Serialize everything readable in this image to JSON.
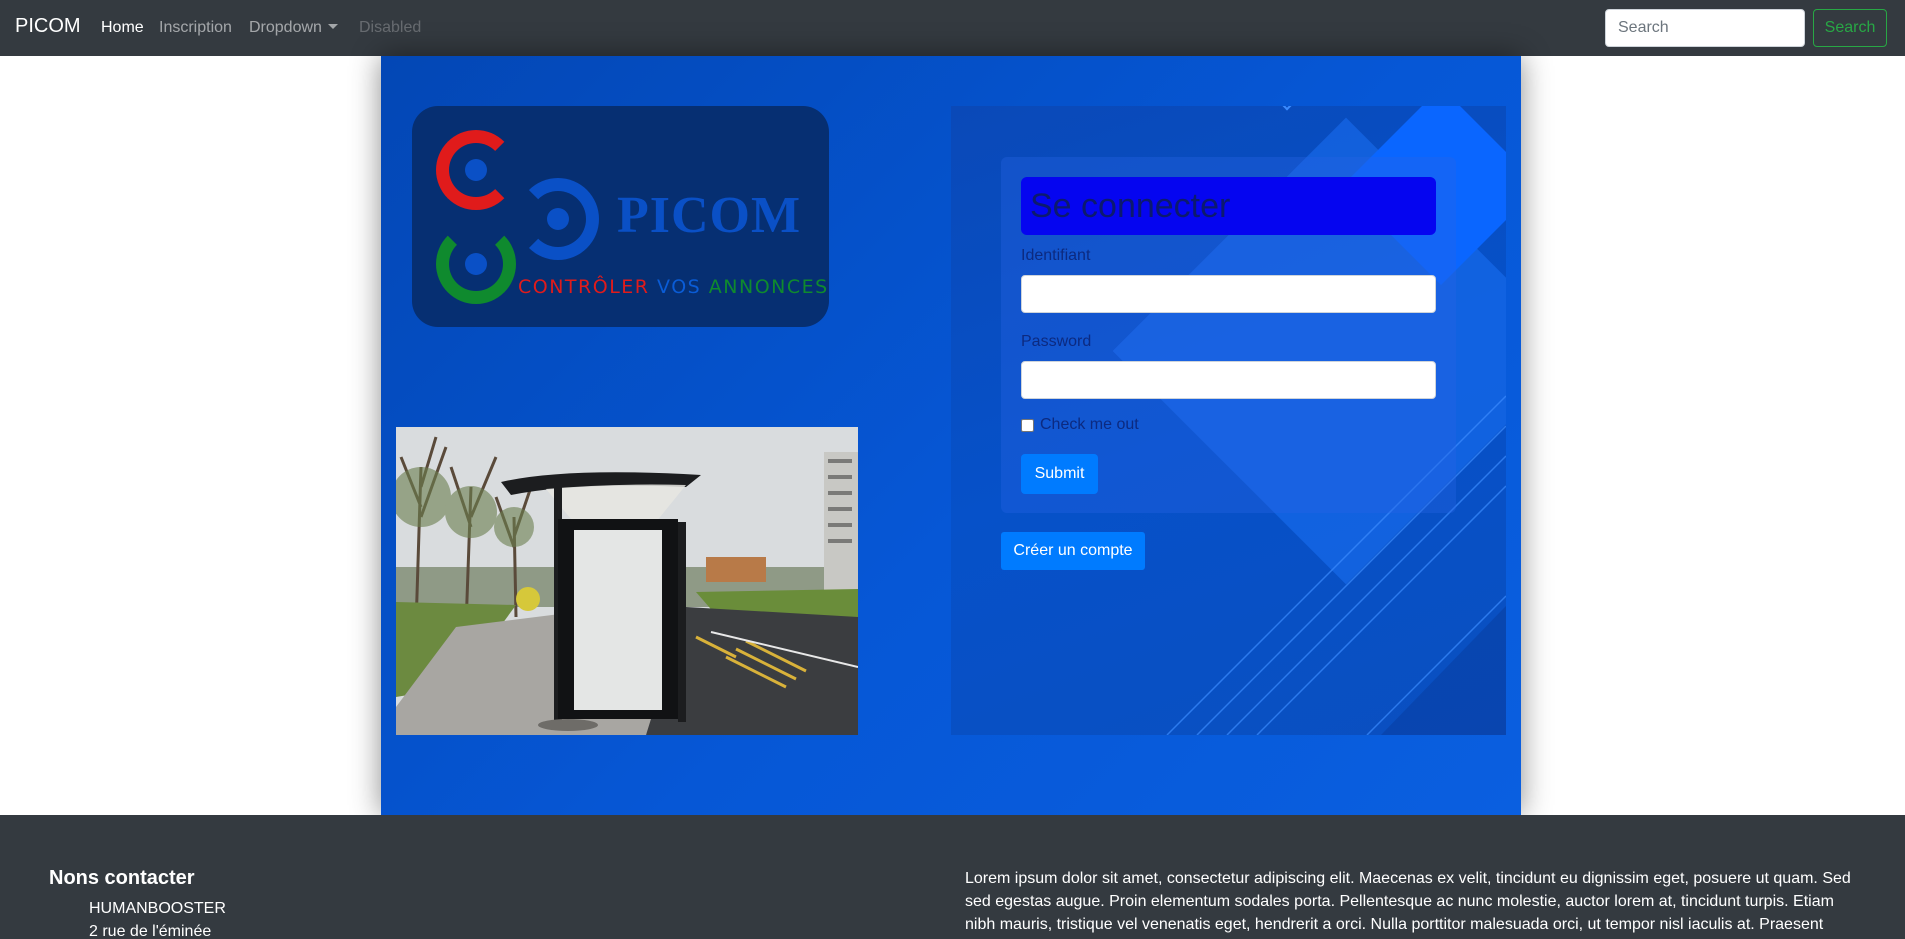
{
  "navbar": {
    "brand": "PICOM",
    "links": [
      {
        "label": "Home",
        "state": "active"
      },
      {
        "label": "Inscription",
        "state": "normal"
      },
      {
        "label": "Dropdown",
        "state": "dropdown"
      },
      {
        "label": "Disabled",
        "state": "disabled"
      }
    ],
    "search_placeholder": "Search",
    "search_button": "Search"
  },
  "logo": {
    "word": "PICOM",
    "tagline_red": "CONTRÔLER",
    "tagline_blue": "VOS",
    "tagline_green": "ANNONCES",
    "colors": {
      "red": "#e01b1b",
      "blue": "#0a5cd6",
      "green": "#0f8a2e",
      "card": "#062f72"
    }
  },
  "photo": {
    "subject": "bus-shelter-billboard-photo"
  },
  "login_form": {
    "title": "Se connecter",
    "identifier_label": "Identifiant",
    "identifier_value": "",
    "password_label": "Password",
    "password_value": "",
    "checkbox_label": "Check me out",
    "checkbox_checked": false,
    "submit_label": "Submit",
    "create_account_label": "Créer un compte",
    "colors": {
      "title_bg": "#0505f0",
      "button": "#007bff"
    }
  },
  "footer": {
    "contact_title": "Nons contacter",
    "contact_lines": [
      "HUMANBOOSTER",
      "2 rue de l'éminée"
    ],
    "lorem": "Lorem ipsum dolor sit amet, consectetur adipiscing elit. Maecenas ex velit, tincidunt eu dignissim eget, posuere ut quam. Sed sed egestas augue. Proin elementum sodales porta. Pellentesque ac nunc molestie, auctor lorem at, tincidunt turpis. Etiam nibh mauris, tristique vel venenatis eget, hendrerit a orci. Nulla porttitor malesuada orci, ut tempor nisl iaculis at. Praesent"
  }
}
